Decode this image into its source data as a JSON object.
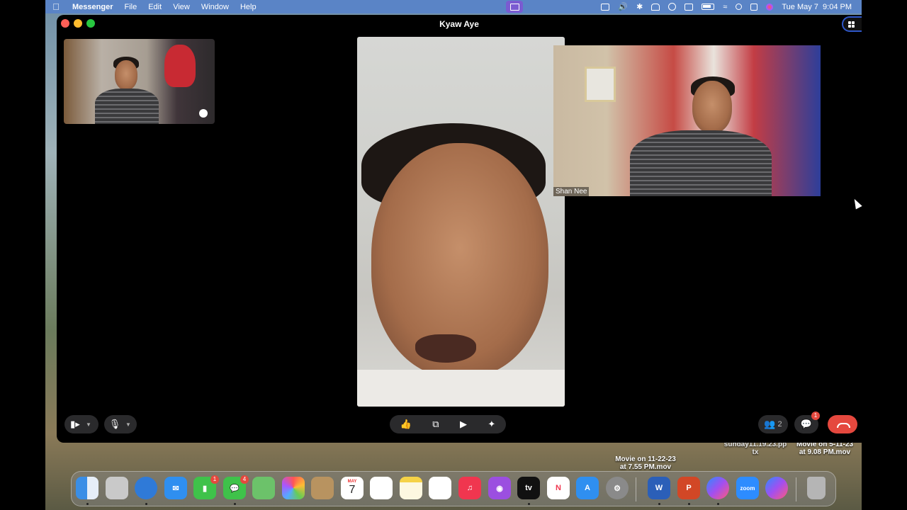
{
  "menubar": {
    "app_name": "Messenger",
    "items": [
      "File",
      "Edit",
      "View",
      "Window",
      "Help"
    ],
    "clock_date": "Tue May 7",
    "clock_time": "9:04 PM",
    "status_icons": [
      "screen-share-icon",
      "display-icon",
      "volume-icon",
      "bluetooth-icon",
      "bed-icon",
      "play-icon",
      "keyboard-icon",
      "battery-icon",
      "wifi-icon",
      "spotlight-search-icon",
      "control-center-icon",
      "siri-icon"
    ]
  },
  "window": {
    "title": "Kyaw Aye",
    "participants": {
      "right_tile_label": "Shan Nee"
    }
  },
  "controls": {
    "participants_count": "2",
    "chat_badge": "1",
    "left": [
      "camera-icon",
      "microphone-icon"
    ],
    "center": [
      "thumbs-up-icon",
      "switch-camera-icon",
      "share-screen-icon",
      "effects-icon"
    ],
    "right": [
      "participants-icon",
      "chat-icon",
      "end-call-icon"
    ]
  },
  "desktop_files": [
    {
      "line1": "Movie on 11-22-23",
      "line2": "at 7.55 PM.mov"
    },
    {
      "line1": "sunday11.19.23.pp",
      "line2": "tx"
    },
    {
      "line1": "Movie on 5-11-23",
      "line2": "at 9.08 PM.mov"
    }
  ],
  "dock": {
    "calendar_month": "MAY",
    "calendar_day": "7",
    "facetime_badge": "1",
    "messages_badge": "4",
    "apps": [
      {
        "name": "finder-icon",
        "color": "#3a8ee6"
      },
      {
        "name": "launchpad-icon",
        "color": "#c9c9c9"
      },
      {
        "name": "safari-icon",
        "color": "#2f7ad8"
      },
      {
        "name": "mail-icon",
        "color": "#2f8ff0"
      },
      {
        "name": "facetime-icon",
        "color": "#3fc24a"
      },
      {
        "name": "messages-icon",
        "color": "#3fc24a"
      },
      {
        "name": "maps-icon",
        "color": "#6cc26a"
      },
      {
        "name": "photos-icon",
        "color": "#f2f2f2"
      },
      {
        "name": "contacts-icon",
        "color": "#b89360"
      },
      {
        "name": "calendar-icon",
        "color": "#ffffff"
      },
      {
        "name": "reminders-icon",
        "color": "#ffffff"
      },
      {
        "name": "notes-icon",
        "color": "#f5d247"
      },
      {
        "name": "freeform-icon",
        "color": "#ffffff"
      },
      {
        "name": "music-icon",
        "color": "#f0364f"
      },
      {
        "name": "podcasts-icon",
        "color": "#9b4fe0"
      },
      {
        "name": "apple-tv-icon",
        "color": "#111111"
      },
      {
        "name": "news-icon",
        "color": "#ffffff"
      },
      {
        "name": "app-store-icon",
        "color": "#2f8ff0"
      },
      {
        "name": "system-settings-icon",
        "color": "#8a8a8a"
      },
      {
        "name": "word-icon",
        "color": "#2b5fb8"
      },
      {
        "name": "powerpoint-icon",
        "color": "#d24726"
      },
      {
        "name": "messenger-icon",
        "color": "#a24ff0"
      },
      {
        "name": "zoom-icon",
        "color": "#2d8cff"
      },
      {
        "name": "messenger-icon-2",
        "color": "#a24ff0"
      },
      {
        "name": "trash-icon",
        "color": "#b5b5b5"
      }
    ],
    "zoom_label": "zoom",
    "tv_label": "tv",
    "word_letter": "W",
    "powerpoint_letter": "P"
  }
}
